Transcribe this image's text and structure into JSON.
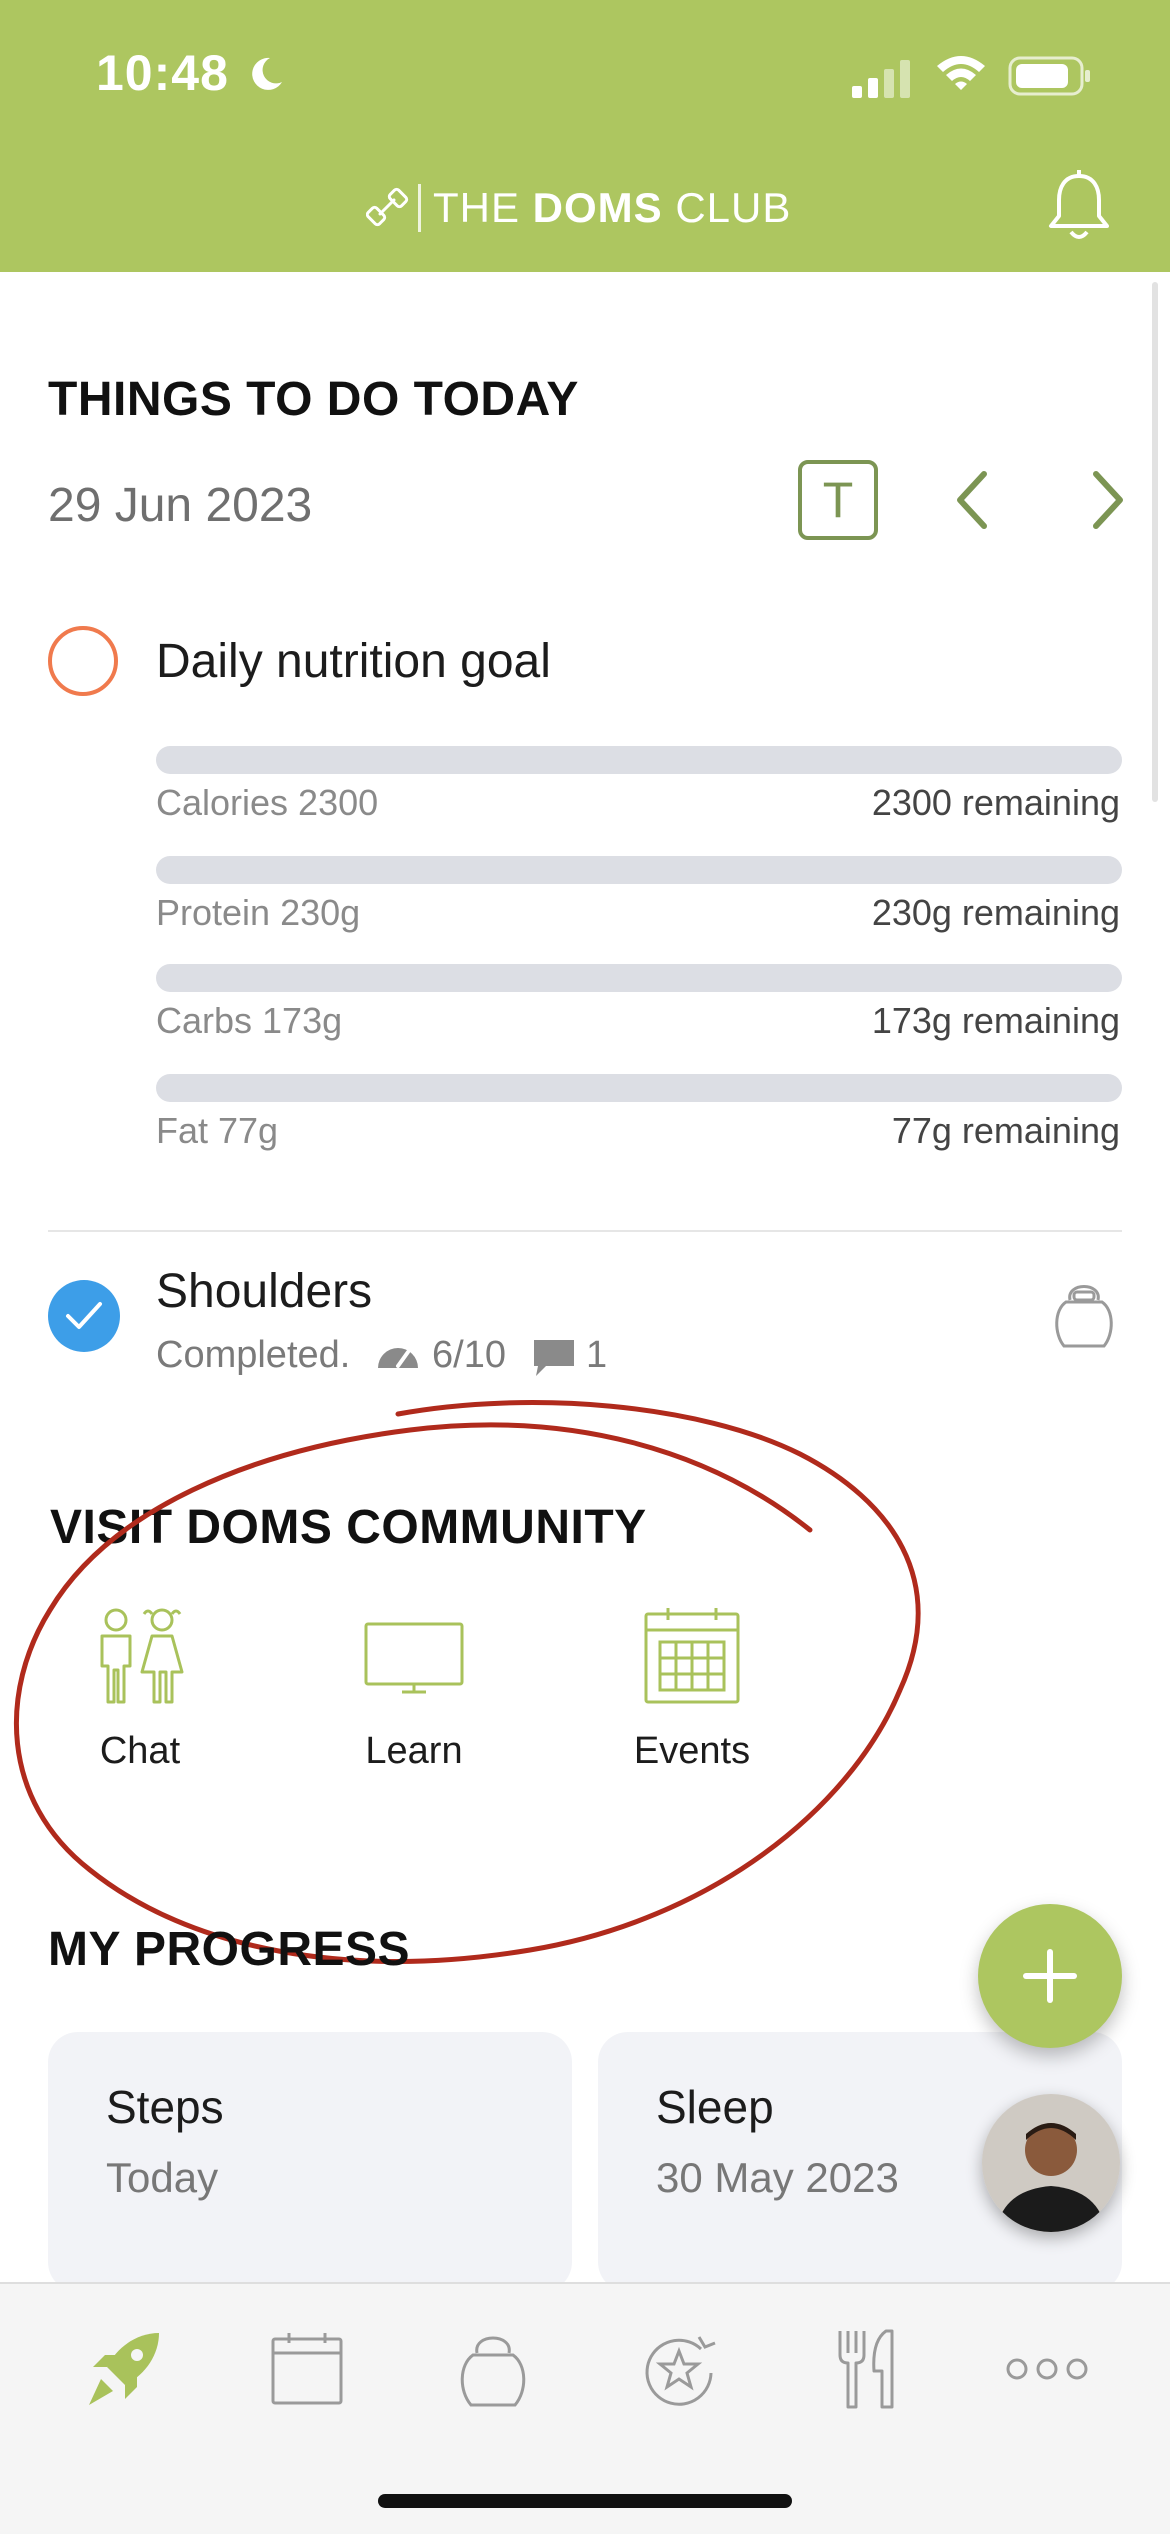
{
  "status_bar": {
    "time": "10:48"
  },
  "header": {
    "brand_prefix": "THE ",
    "brand_bold": "DOMS",
    "brand_suffix": " CLUB"
  },
  "todo": {
    "title": "THINGS TO DO TODAY",
    "date": "29 Jun 2023",
    "today_button": "T",
    "nutrition": {
      "title": "Daily nutrition goal",
      "macros": [
        {
          "label": "Calories 2300",
          "remaining": "2300 remaining",
          "progress": 0
        },
        {
          "label": "Protein 230g",
          "remaining": "230g remaining",
          "progress": 0
        },
        {
          "label": "Carbs 173g",
          "remaining": "173g remaining",
          "progress": 0
        },
        {
          "label": "Fat 77g",
          "remaining": "77g remaining",
          "progress": 0
        }
      ]
    },
    "workout": {
      "title": "Shoulders",
      "status": "Completed.",
      "rating": "6/10",
      "comments": "1"
    }
  },
  "community": {
    "title": "VISIT DOMS COMMUNITY",
    "items": [
      {
        "label": "Chat",
        "icon": "people-icon"
      },
      {
        "label": "Learn",
        "icon": "monitor-icon"
      },
      {
        "label": "Events",
        "icon": "calendar-icon"
      }
    ]
  },
  "progress": {
    "title": "MY PROGRESS",
    "cards": [
      {
        "title": "Steps",
        "subtitle": "Today"
      },
      {
        "title": "Sleep",
        "subtitle": "30 May 2023"
      }
    ]
  },
  "fab": {
    "label": "+"
  },
  "tabs": [
    {
      "icon": "rocket-icon",
      "active": true
    },
    {
      "icon": "calendar-icon",
      "active": false
    },
    {
      "icon": "kettlebell-icon",
      "active": false
    },
    {
      "icon": "star-badge-icon",
      "active": false
    },
    {
      "icon": "fork-knife-icon",
      "active": false
    },
    {
      "icon": "more-icon",
      "active": false
    }
  ],
  "colors": {
    "brand": "#adc660",
    "accent_dark": "#7c9553",
    "check": "#3d9ee8",
    "todo_ring": "#f07a4d",
    "annotation": "#b02a1c"
  }
}
